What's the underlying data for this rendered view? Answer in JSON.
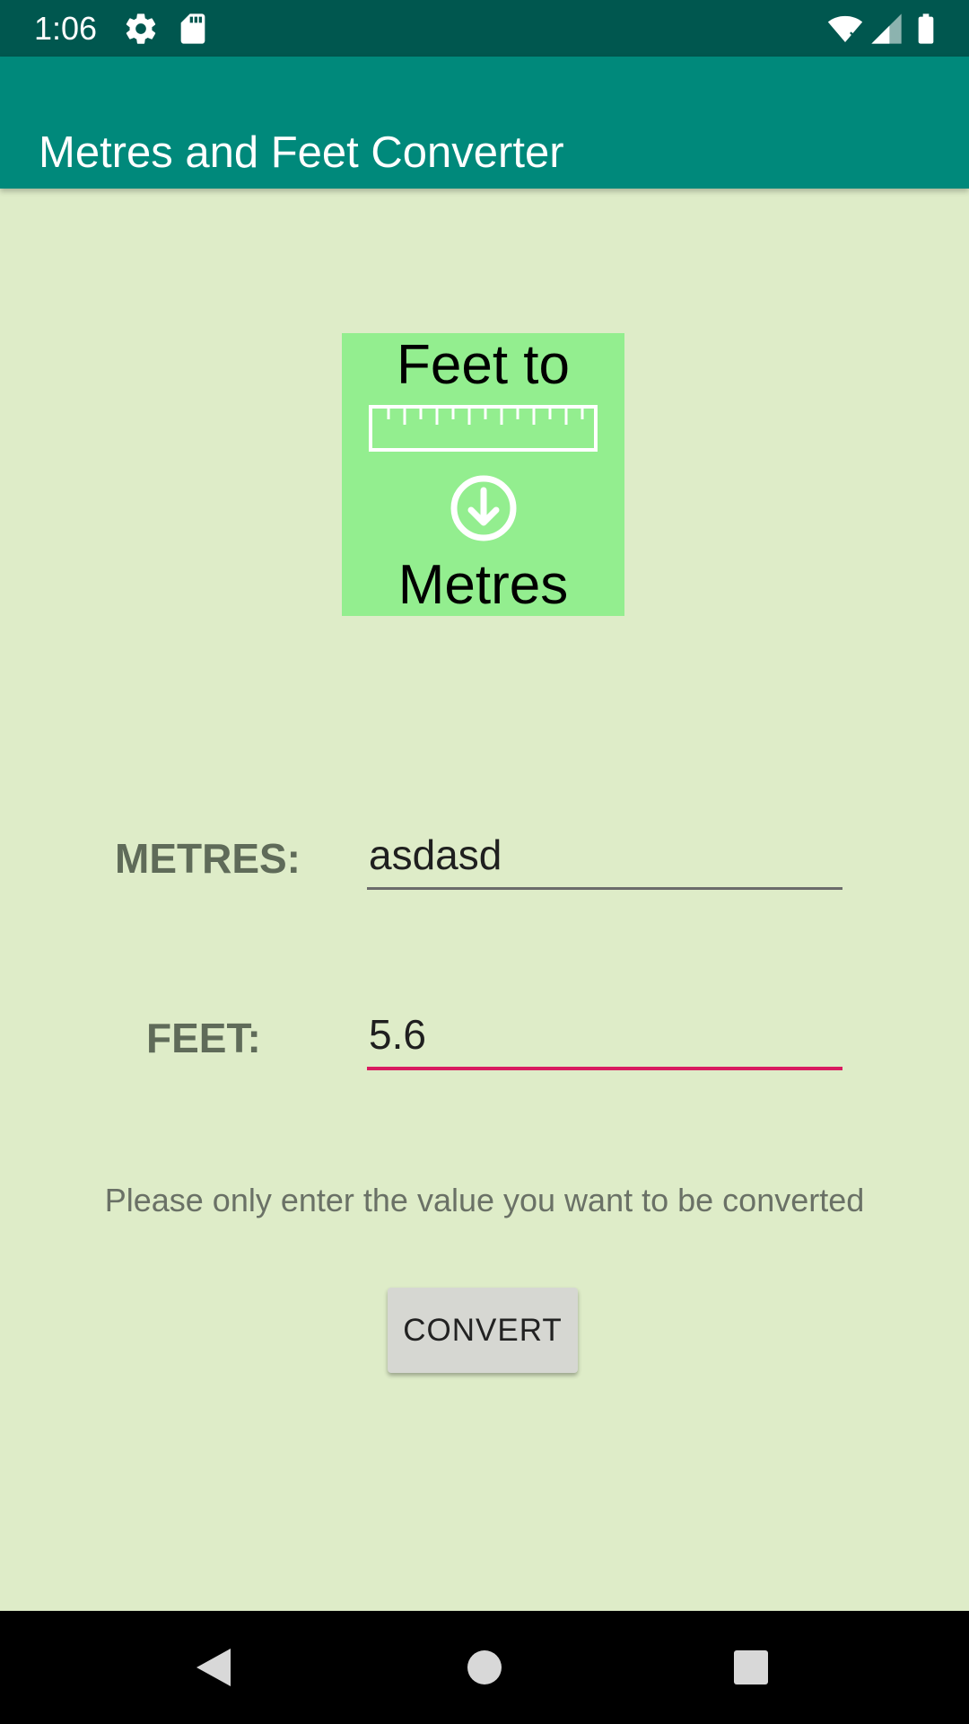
{
  "status_bar": {
    "time": "1:06",
    "icons": [
      "gear-icon",
      "sd-card-icon",
      "wifi-icon",
      "signal-icon",
      "battery-icon"
    ]
  },
  "app_bar": {
    "title": "Metres and Feet Converter",
    "color": "#00897b"
  },
  "logo": {
    "line1": "Feet to",
    "line2": "Metres",
    "icons": [
      "ruler-icon",
      "arrow-down-circle-icon"
    ],
    "background": "#93ee8f"
  },
  "form": {
    "metres_label": "METRES:",
    "metres_value": "asdasd",
    "feet_label": "FEET:",
    "feet_value": "5.6",
    "hint": "Please only enter the value you want to be converted",
    "convert_label": "CONVERT",
    "accent_color": "#d81b60",
    "background": "#deecc8"
  },
  "nav_bar": {
    "buttons": [
      "back-icon",
      "home-icon",
      "recents-icon"
    ]
  }
}
